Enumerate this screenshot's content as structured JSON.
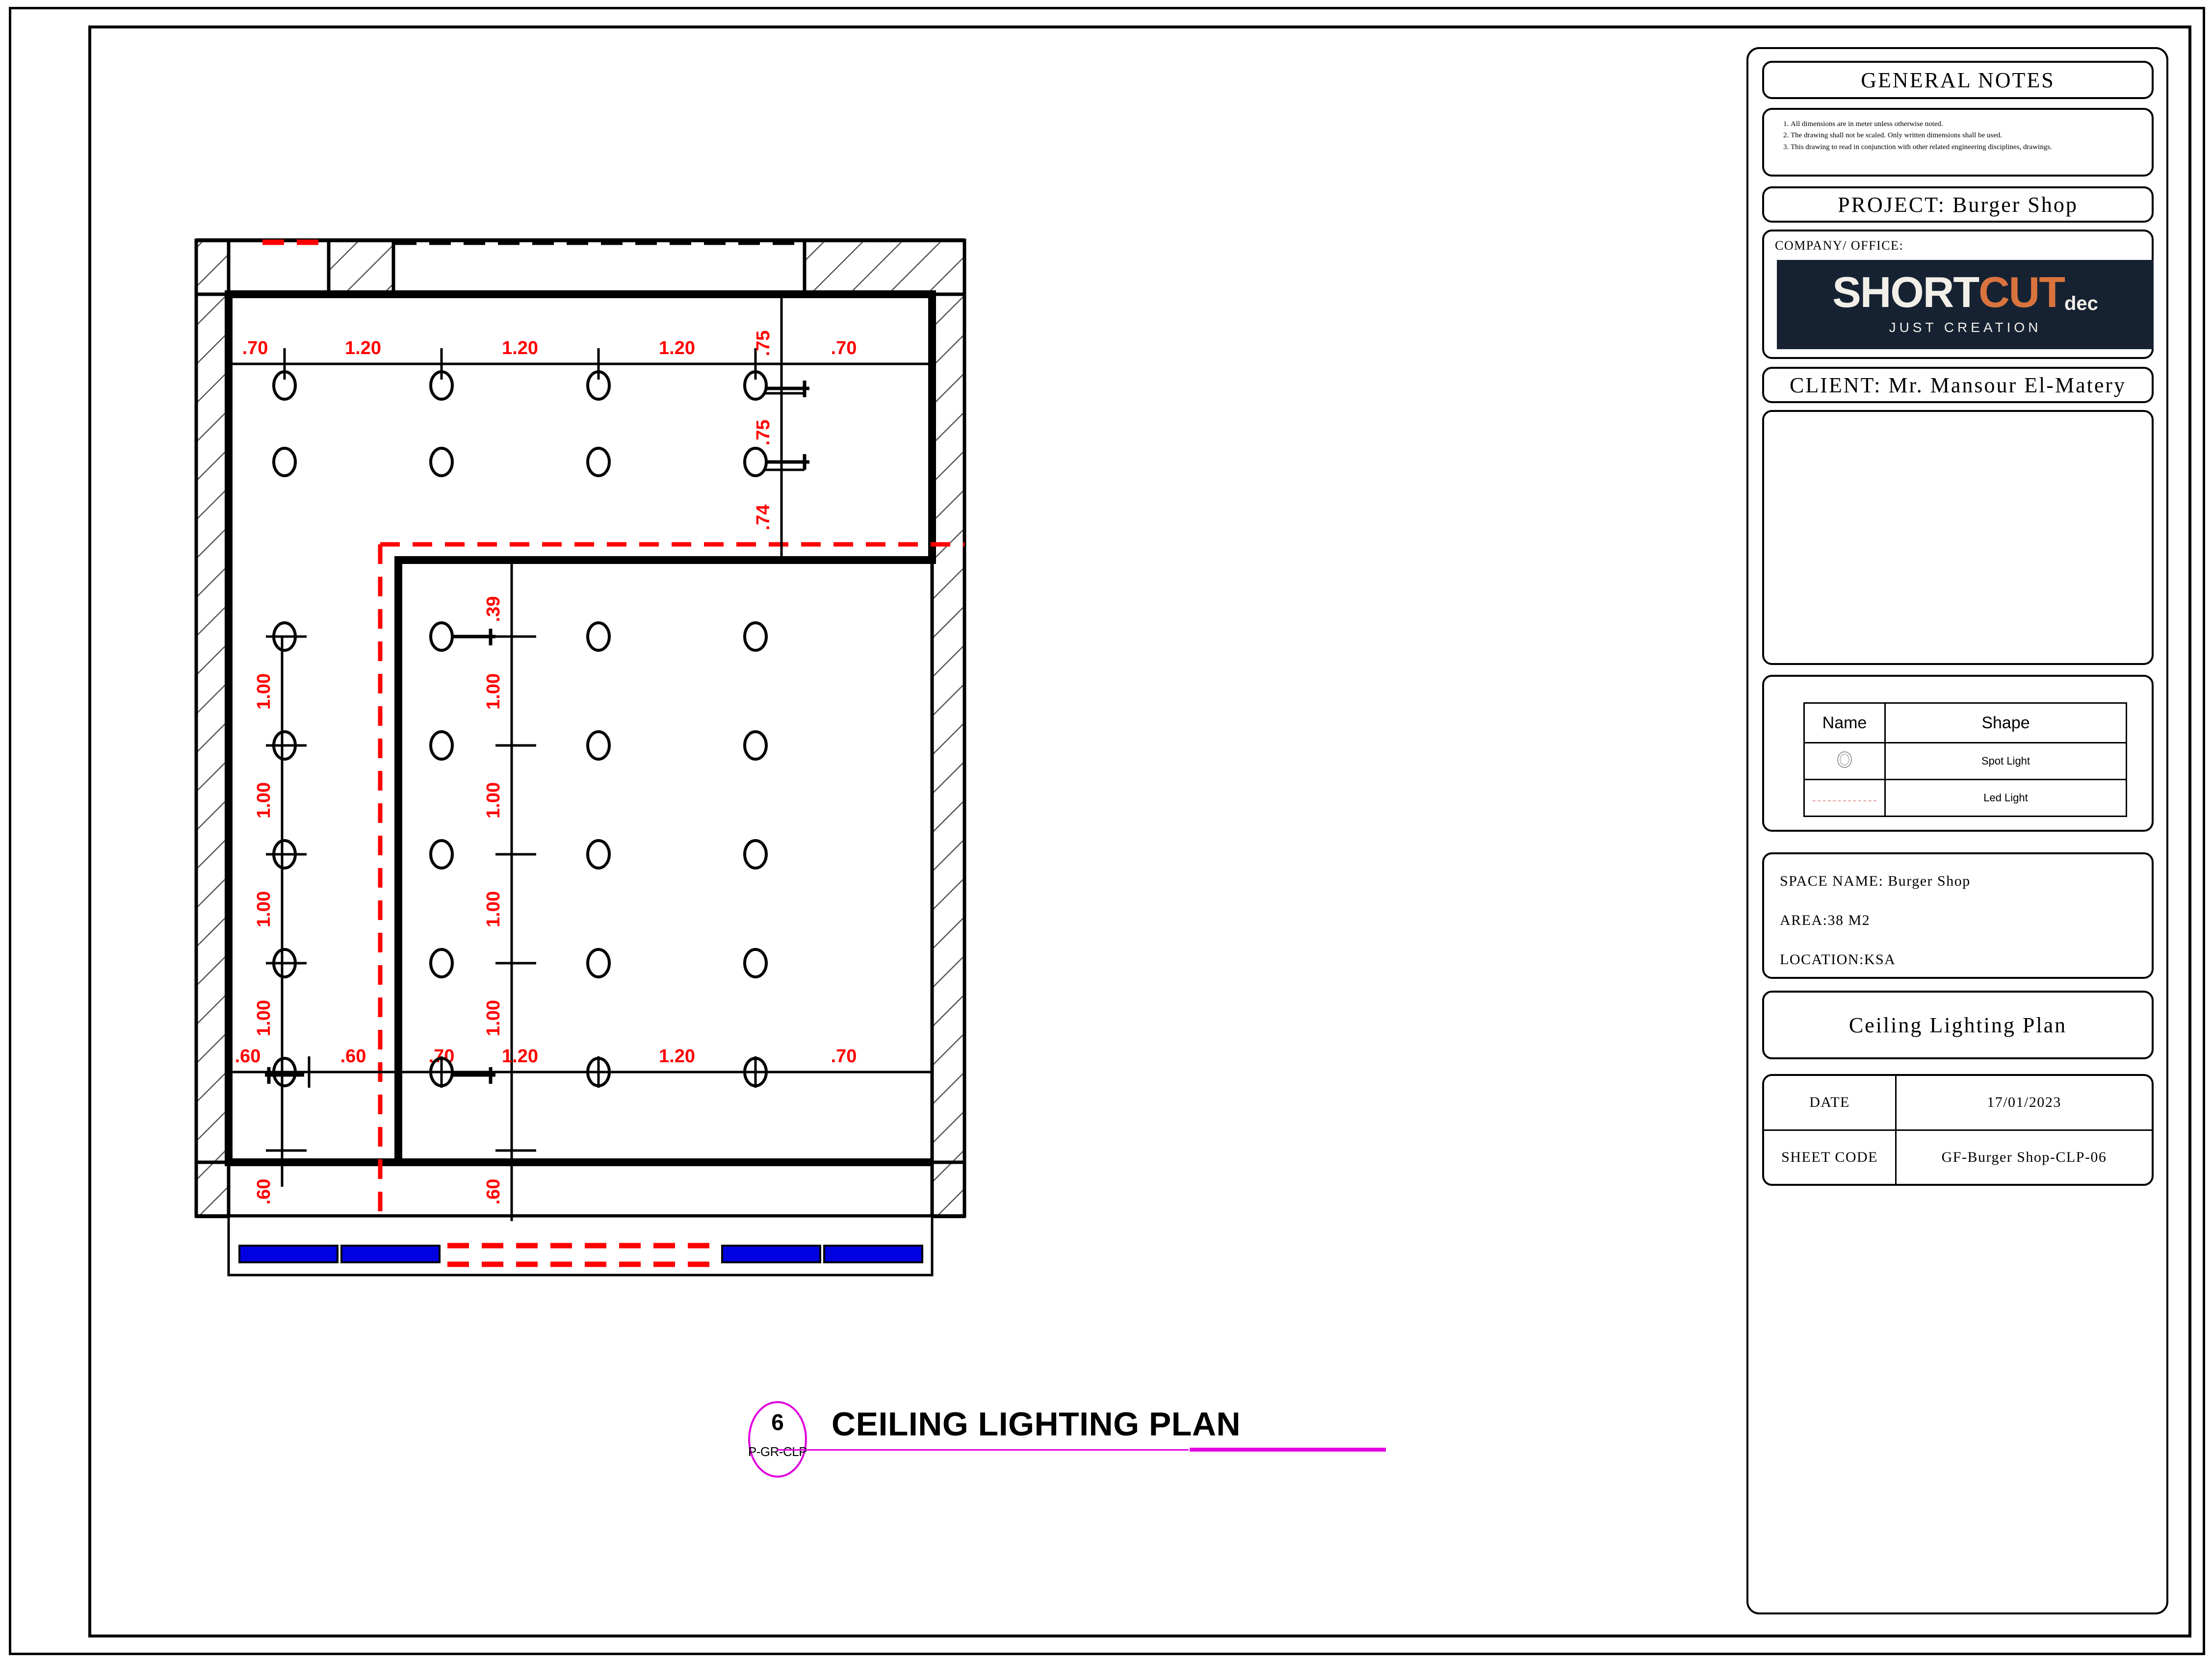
{
  "sheet": {
    "drawing_title_tag": {
      "number": "6",
      "code": "P-GR-CLP"
    },
    "drawing_title": "CEILING LIGHTING PLAN",
    "accent_magenta": "#e000e0"
  },
  "title_block": {
    "general_notes_header": "GENERAL  NOTES",
    "general_notes": [
      "All dimensions are in meter unless otherwise noted.",
      "The drawing shall not be scaled. Only written dimensions shall be used.",
      "This drawing to read in conjunction with other related engineering disciplines, drawings."
    ],
    "project_label": "PROJECT: Burger Shop",
    "company_label": "COMPANY/ OFFICE:",
    "logo": {
      "word_s": "S",
      "word_short": "HORT",
      "word_cut": "CUT",
      "word_dec": "dec",
      "tagline": "JUST CREATION",
      "bg_color": "#162232",
      "accent_color": "#d9743f",
      "text_color": "#f2efe9"
    },
    "client_label": "CLIENT: Mr. Mansour El-Matery",
    "legend": {
      "headers": [
        "Name",
        "Shape"
      ],
      "rows": [
        {
          "symbol": "spot-light-circle-icon",
          "name": "Spot Light"
        },
        {
          "symbol": "led-light-dashed-icon",
          "name": "Led Light"
        }
      ]
    },
    "space_info": {
      "space_name": "SPACE NAME: Burger Shop",
      "area": "AREA:38 M2",
      "location": "LOCATION:KSA"
    },
    "sheet_title": "Ceiling Lighting Plan",
    "date_table": {
      "date_label": "DATE",
      "date_value": "17/01/2023",
      "sheet_code_label": "SHEET CODE",
      "sheet_code_value": "GF-Burger Shop-CLP-06"
    }
  },
  "plan": {
    "dim_color": "#ff0000",
    "led_color": "#ff0000",
    "glazing_color": "#0000e0",
    "dimensions": {
      "top_chain": [
        ".70",
        "1.20",
        "1.20",
        "1.20",
        ".70"
      ],
      "bottom_left_chain": [
        ".60",
        ".60"
      ],
      "bottom_right_chain": [
        ".70",
        "1.20",
        "1.20",
        ".70"
      ],
      "right_vertical_chain": [
        ".75",
        ".75",
        ".74"
      ],
      "left_vertical_chain": [
        "1.00",
        "1.00",
        "1.00",
        "1.00",
        ".60"
      ],
      "mid_vertical_chain": [
        ".39",
        "1.00",
        "1.00",
        "1.00",
        "1.00",
        ".60"
      ]
    }
  }
}
